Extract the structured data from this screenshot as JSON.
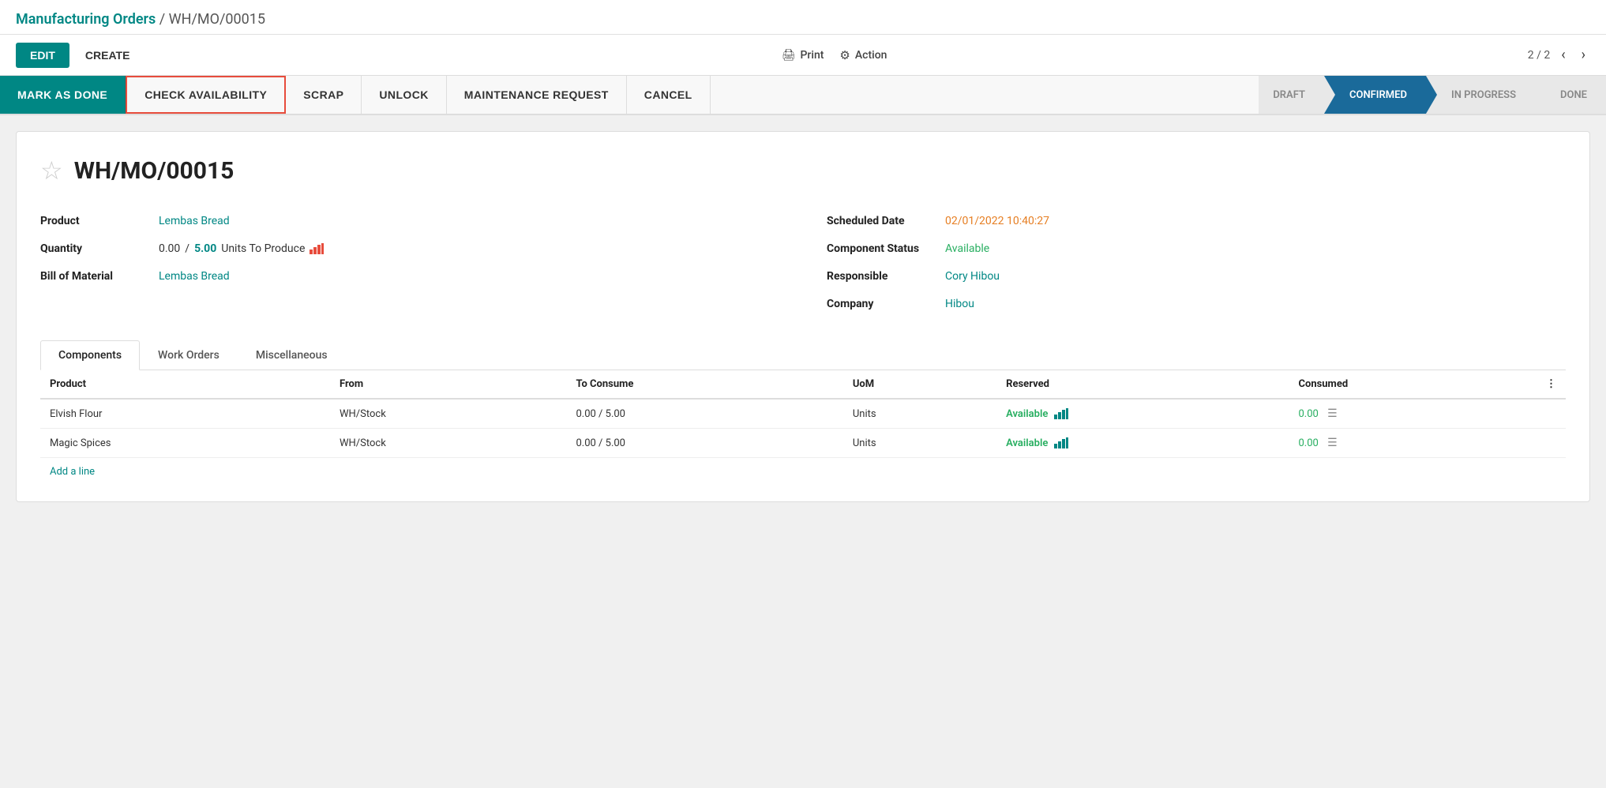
{
  "breadcrumb": {
    "parent": "Manufacturing Orders",
    "separator": "/",
    "current": "WH/MO/00015"
  },
  "toolbar": {
    "edit_label": "EDIT",
    "create_label": "CREATE",
    "print_label": "Print",
    "action_label": "Action",
    "nav_current": "2 / 2"
  },
  "action_bar": {
    "mark_done": "MARK AS DONE",
    "check_availability": "CHECK AVAILABILITY",
    "scrap": "SCRAP",
    "unlock": "UNLOCK",
    "maintenance_request": "MAINTENANCE REQUEST",
    "cancel": "CANCEL"
  },
  "status_steps": [
    {
      "label": "DRAFT",
      "active": false
    },
    {
      "label": "CONFIRMED",
      "active": true
    },
    {
      "label": "IN PROGRESS",
      "active": false
    },
    {
      "label": "DONE",
      "active": false
    }
  ],
  "record": {
    "id": "WH/MO/00015",
    "fields_left": [
      {
        "label": "Product",
        "value": "Lembas Bread",
        "type": "link"
      },
      {
        "label": "Quantity",
        "value": "quantity_special",
        "type": "special"
      },
      {
        "label": "Bill of Material",
        "value": "Lembas Bread",
        "type": "link"
      }
    ],
    "fields_right": [
      {
        "label": "Scheduled Date",
        "value": "02/01/2022 10:40:27",
        "type": "orange"
      },
      {
        "label": "Component Status",
        "value": "Available",
        "type": "green"
      },
      {
        "label": "Responsible",
        "value": "Cory Hibou",
        "type": "link"
      },
      {
        "label": "Company",
        "value": "Hibou",
        "type": "link"
      }
    ],
    "quantity_produced": "0.00",
    "quantity_target": "5.00",
    "quantity_unit": "Units To Produce"
  },
  "tabs": [
    {
      "label": "Components",
      "active": true
    },
    {
      "label": "Work Orders",
      "active": false
    },
    {
      "label": "Miscellaneous",
      "active": false
    }
  ],
  "table": {
    "columns": [
      "Product",
      "From",
      "To Consume",
      "UoM",
      "Reserved",
      "Consumed"
    ],
    "rows": [
      {
        "product": "Elvish Flour",
        "from": "WH/Stock",
        "to_consume": "0.00 / 5.00",
        "uom": "Units",
        "reserved": "Available",
        "consumed": "0.00"
      },
      {
        "product": "Magic Spices",
        "from": "WH/Stock",
        "to_consume": "0.00 / 5.00",
        "uom": "Units",
        "reserved": "Available",
        "consumed": "0.00"
      }
    ],
    "add_line": "Add a line"
  },
  "colors": {
    "primary": "#008784",
    "confirmed_bg": "#1a6a9a",
    "orange": "#e67e22",
    "green": "#27ae60",
    "red": "#e74c3c"
  }
}
